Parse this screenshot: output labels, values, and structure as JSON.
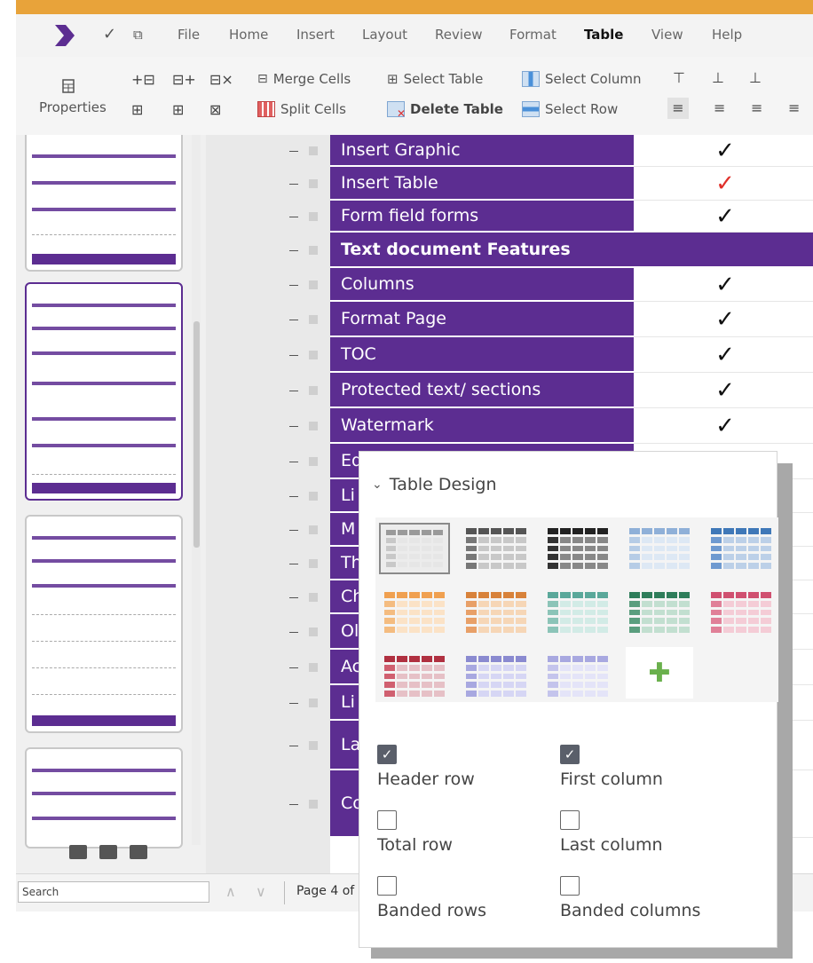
{
  "menu": {
    "items": [
      "File",
      "Home",
      "Insert",
      "Layout",
      "Review",
      "Format",
      "Table",
      "View",
      "Help"
    ],
    "active": "Table"
  },
  "ribbon": {
    "properties": "Properties",
    "merge_cells": "Merge Cells",
    "split_cells": "Split Cells",
    "select_table": "Select Table",
    "delete_table": "Delete Table",
    "select_column": "Select Column",
    "select_row": "Select Row"
  },
  "document": {
    "rows": [
      {
        "label": "Insert Graphic",
        "check": "✓",
        "color": "#111111",
        "type": "row"
      },
      {
        "label": "Insert Table",
        "check": "✓",
        "color": "#e0302a",
        "type": "row"
      },
      {
        "label": "Form field forms",
        "check": "✓",
        "color": "#111111",
        "type": "row"
      },
      {
        "label": "Text document Features",
        "check": "",
        "color": "",
        "type": "header"
      },
      {
        "label": "Columns",
        "check": "✓",
        "color": "#111111",
        "type": "row"
      },
      {
        "label": "Format Page",
        "check": "✓",
        "color": "#111111",
        "type": "row"
      },
      {
        "label": "TOC",
        "check": "✓",
        "color": "#111111",
        "type": "row"
      },
      {
        "label": "Protected text/ sections",
        "check": "✓",
        "color": "#111111",
        "type": "row"
      },
      {
        "label": "Watermark",
        "check": "✓",
        "color": "#111111",
        "type": "row"
      },
      {
        "label": "Ed",
        "check": "",
        "color": "",
        "type": "row"
      },
      {
        "label": "Li",
        "check": "",
        "color": "",
        "type": "row"
      },
      {
        "label": "M",
        "check": "",
        "color": "",
        "type": "row"
      },
      {
        "label": "Th",
        "check": "",
        "color": "",
        "type": "row"
      },
      {
        "label": "Ch",
        "check": "",
        "color": "",
        "type": "row"
      },
      {
        "label": "Ol",
        "check": "",
        "color": "",
        "type": "row"
      },
      {
        "label": "Ac",
        "check": "",
        "color": "",
        "type": "row"
      },
      {
        "label": "Li",
        "check": "",
        "color": "",
        "type": "row"
      },
      {
        "label": "La Su",
        "check": "",
        "color": "",
        "type": "row"
      },
      {
        "label": "Co Ch Da",
        "check": "",
        "color": "",
        "type": "row"
      }
    ]
  },
  "status": {
    "search_placeholder": "Search",
    "page_info": "Page 4 of"
  },
  "table_design": {
    "title": "Table Design",
    "options": {
      "header_row": "Header row",
      "first_column": "First column",
      "total_row": "Total row",
      "last_column": "Last column",
      "banded_rows": "Banded rows",
      "banded_columns": "Banded columns"
    },
    "checked": {
      "header_row": true,
      "first_column": true,
      "total_row": false,
      "last_column": false,
      "banded_rows": false,
      "banded_columns": false
    }
  },
  "colors": {
    "accent": "#5c2d91",
    "topbar": "#e8a33a",
    "check_red": "#e0302a"
  }
}
